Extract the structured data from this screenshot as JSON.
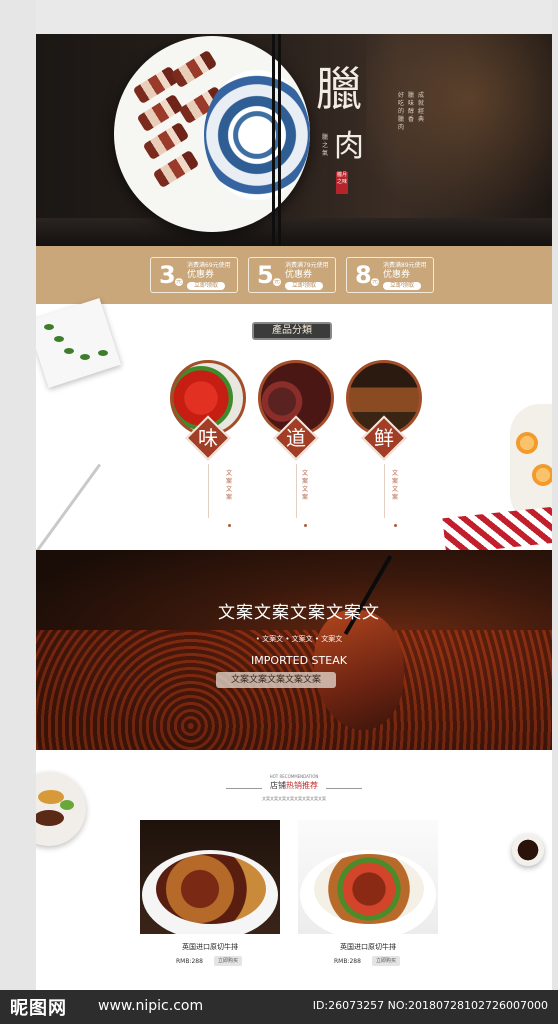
{
  "hero": {
    "title": "臘",
    "title_2": "肉",
    "small_left": "臘之氣",
    "description_col1": "好吃的臘肉",
    "description_col2": "臘味醇香",
    "description_col3": "成就經典",
    "seal_text": "臘月之味"
  },
  "coupons": [
    {
      "num": "3",
      "currency": "元",
      "condition": "消费满69元使用",
      "name": "优惠券",
      "get_label": "立即领取"
    },
    {
      "num": "5",
      "currency": "元",
      "condition": "消费满79元使用",
      "name": "优惠券",
      "get_label": "立即领取"
    },
    {
      "num": "8",
      "currency": "元",
      "condition": "消费满89元使用",
      "name": "优惠券",
      "get_label": "立即领取"
    }
  ],
  "categories": {
    "header": "產品分類",
    "items": [
      {
        "char": "味",
        "caption": "文案文案"
      },
      {
        "char": "道",
        "caption": "文案文案"
      },
      {
        "char": "鲜",
        "caption": "文案文案"
      }
    ]
  },
  "steak_banner": {
    "title": "文案文案文案文案文",
    "subtitle": "• 文案文 • 文案文 • 文案文",
    "english": "IMPORTED STEAK",
    "pill": "文案文案文案文案文案"
  },
  "recommend": {
    "en_label": "HOT RECOMMENDATION",
    "title_prefix": "店铺",
    "title_highlight": "热销推荐",
    "cn_label": "文案文案文案文案文案文案文案文案"
  },
  "products": [
    {
      "name": "英国进口原切牛排",
      "price": "RMB:288",
      "buy_label": "立即购买"
    },
    {
      "name": "英国进口原切牛排",
      "price": "RMB:288",
      "buy_label": "立即购买"
    }
  ],
  "watermark": {
    "logo": "昵图网",
    "url": "www.nipic.com",
    "id_text": "ID:26073257 NO:20180728102726007000"
  },
  "colors": {
    "coupon_band": "#c9a77a",
    "accent_red": "#a13e25",
    "highlight_red": "#c12a2a"
  }
}
